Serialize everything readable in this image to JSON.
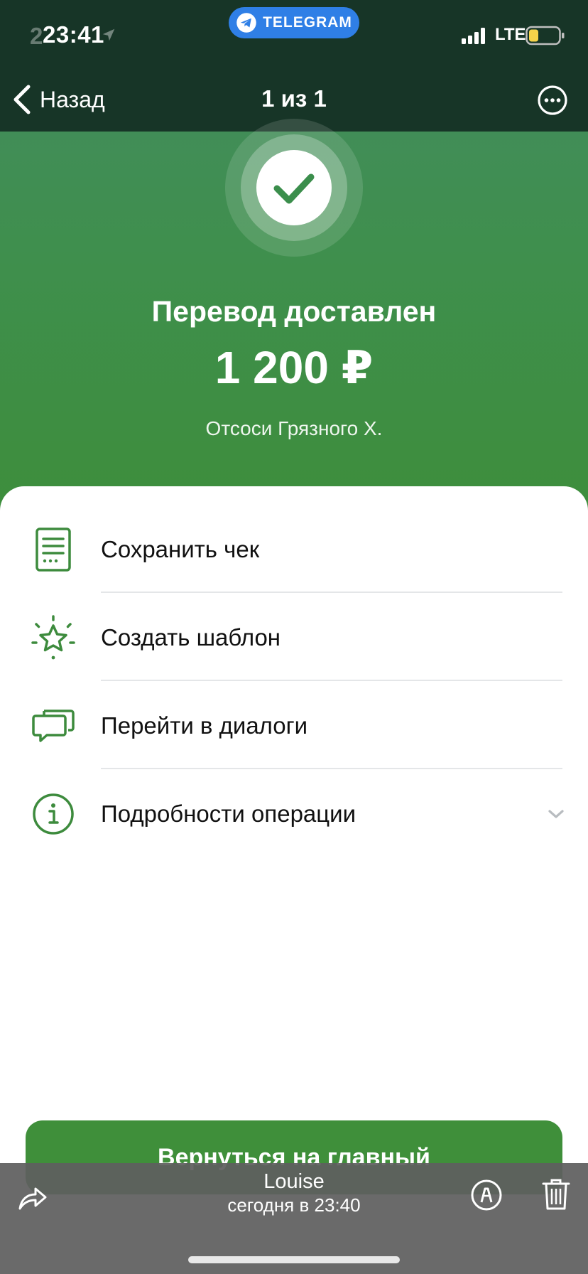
{
  "status_bar": {
    "time": "23:41",
    "time_ghost": "2",
    "telegram_label": "TELEGRAM",
    "network": "LTE",
    "icons": [
      "location-arrow-icon",
      "telegram-plane-icon",
      "cellular-signal-icon",
      "battery-low-icon"
    ]
  },
  "nav": {
    "back_label": "Назад",
    "title": "1 из 1",
    "more_icon": "ellipsis-circle-icon"
  },
  "hero": {
    "status_icon": "checkmark-circle-icon",
    "title": "Перевод доставлен",
    "amount": "1 200 ₽",
    "recipient": "Отсоси Грязного Х."
  },
  "actions": [
    {
      "label": "Сохранить чек",
      "icon": "receipt-icon"
    },
    {
      "label": "Создать шаблон",
      "icon": "star-sparkle-icon"
    },
    {
      "label": "Перейти в диалоги",
      "icon": "chat-bubbles-icon"
    },
    {
      "label": "Подробности операции",
      "icon": "info-circle-icon",
      "trailing_icon": "chevron-down-icon"
    }
  ],
  "primary_button": {
    "label": "Вернуться на главный"
  },
  "viewer": {
    "name": "Louise",
    "date": "сегодня в 23:40",
    "icons": [
      "share-icon",
      "markup-icon",
      "trash-icon"
    ]
  },
  "colors": {
    "top_bar": "#173527",
    "brand_green": "#3f8f3a",
    "hero_green": "#448b62",
    "telegram_blue": "#2f7fe6",
    "viewer_bar": "#5f5f5f"
  }
}
